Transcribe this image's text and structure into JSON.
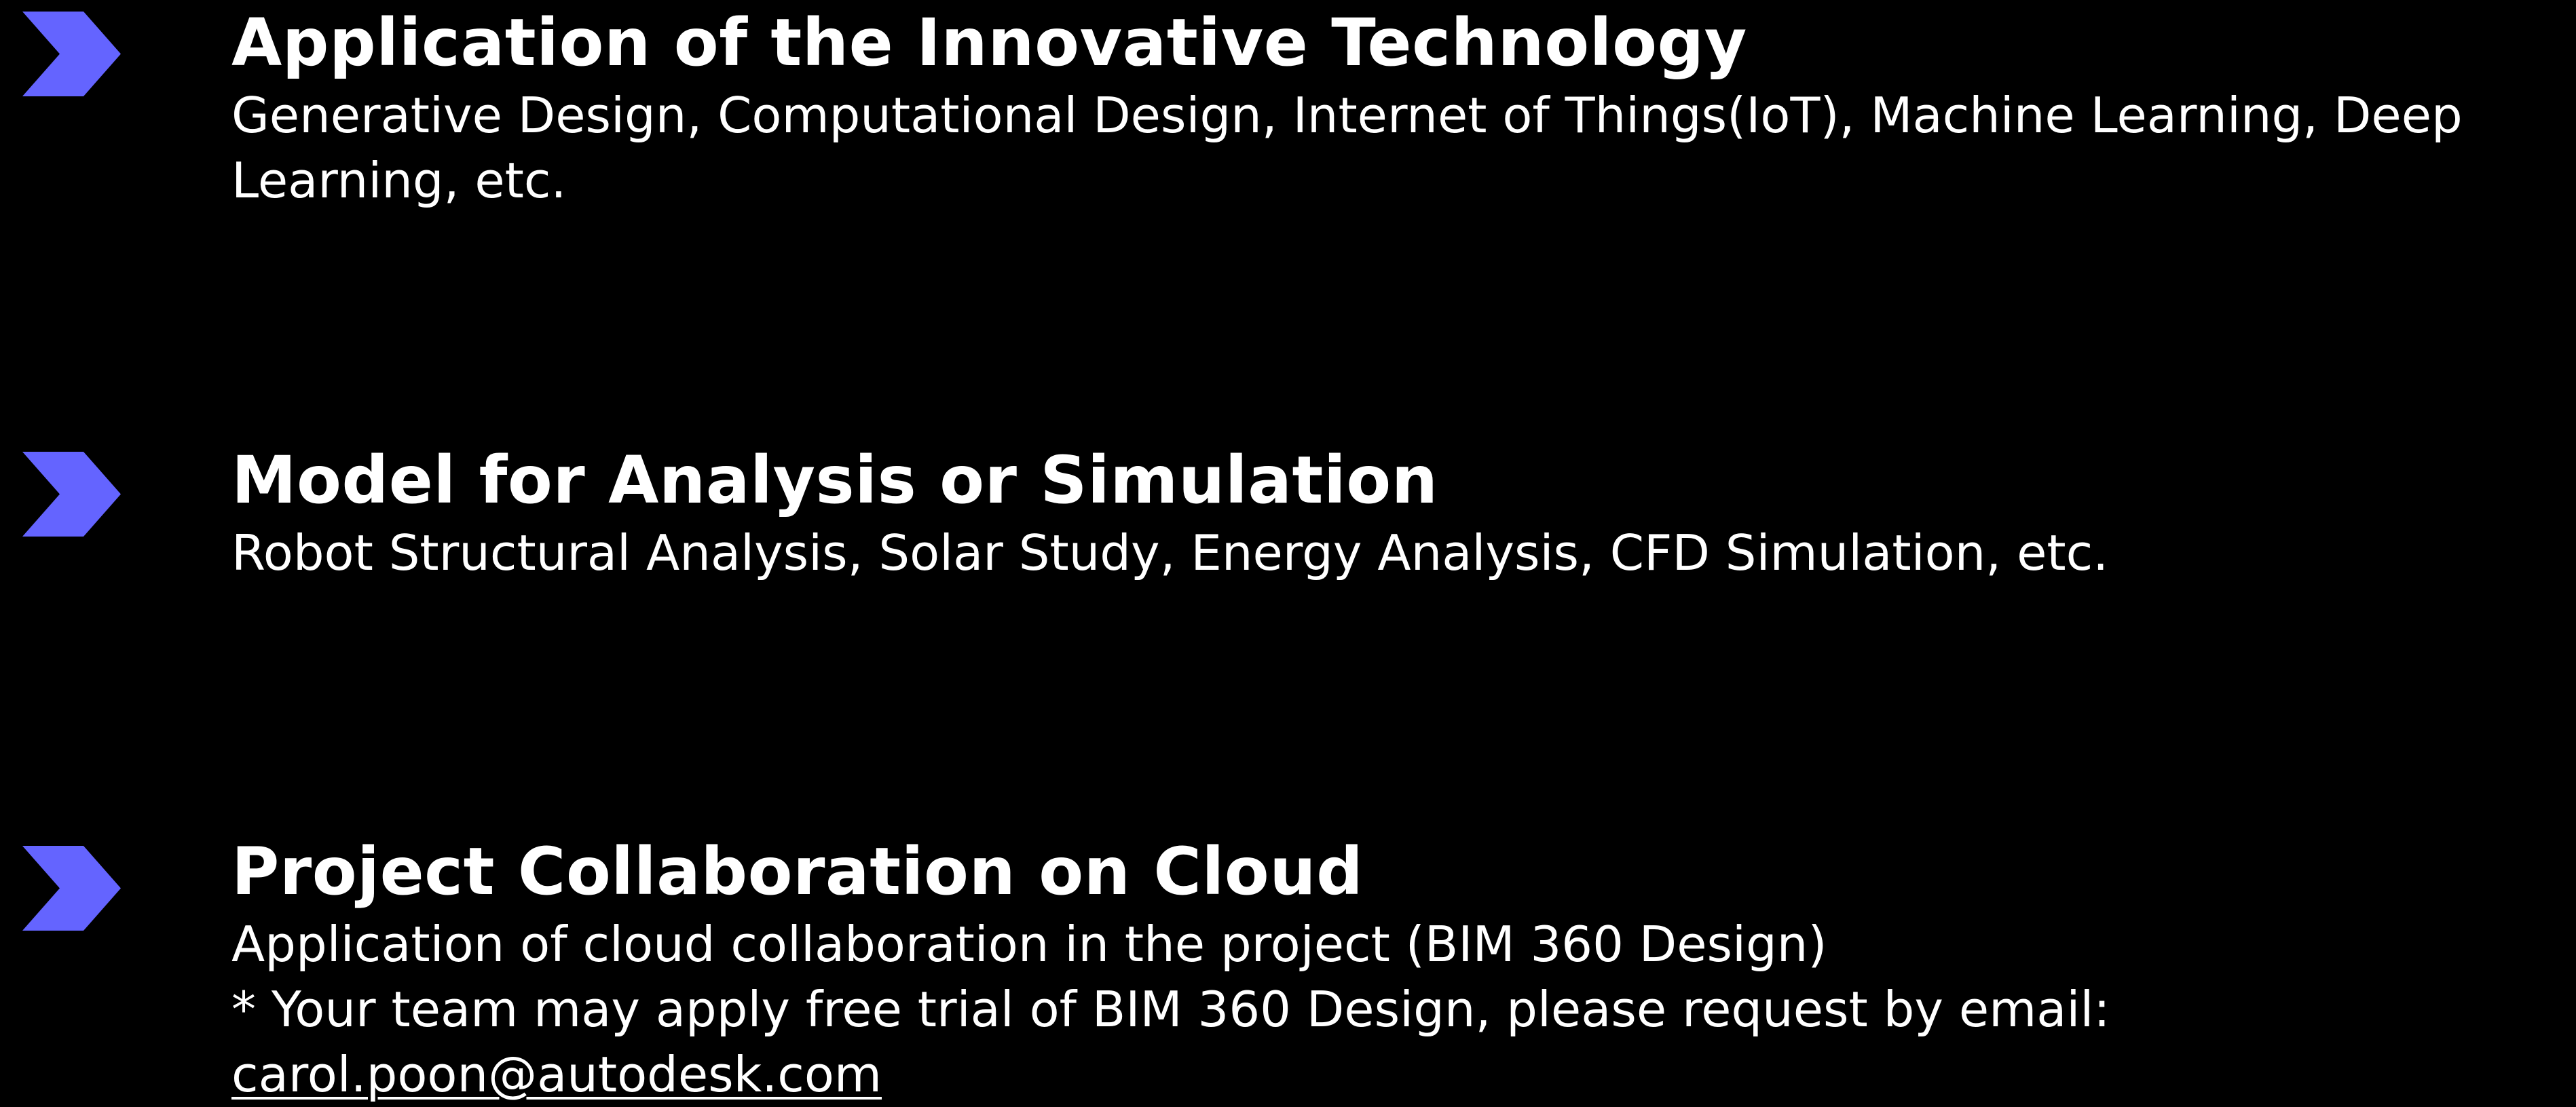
{
  "accent_color": "#6464ff",
  "items": [
    {
      "icon": "chevron-right-icon",
      "title": "Application of the Innovative Technology",
      "lines": [
        "Generative Design, Computational Design, Internet of Things(IoT), Machine Learning, Deep",
        "Learning, etc."
      ]
    },
    {
      "icon": "chevron-right-icon",
      "title": "Model for Analysis or Simulation",
      "lines": [
        "Robot Structural Analysis, Solar Study, Energy Analysis, CFD Simulation, etc."
      ]
    },
    {
      "icon": "chevron-right-icon",
      "title": "Project Collaboration on Cloud",
      "lines": [
        "Application of cloud collaboration in the project (BIM 360 Design)",
        "* Your team may apply free trial of BIM 360 Design, please request by email:"
      ],
      "email": "carol.poon@autodesk.com"
    }
  ]
}
